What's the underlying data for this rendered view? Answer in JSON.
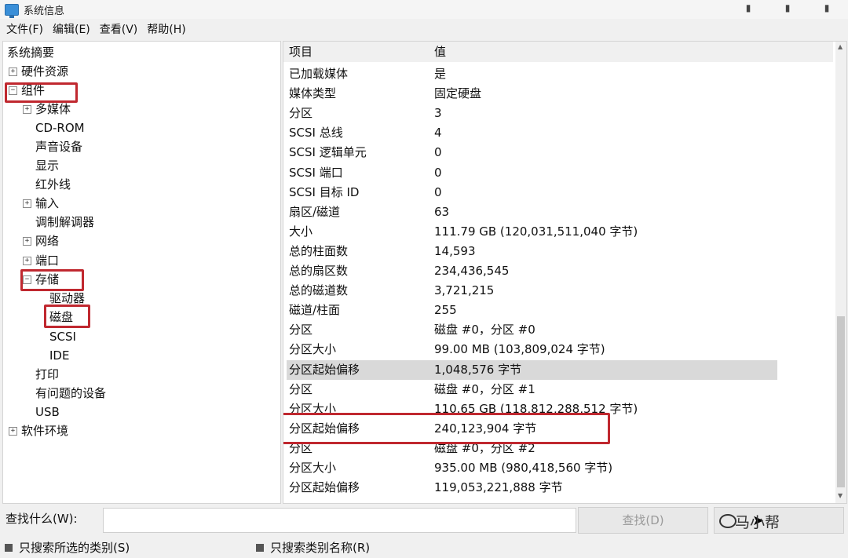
{
  "window": {
    "title": "系统信息",
    "controls": [
      "▮",
      "▮",
      "▮"
    ]
  },
  "menu": [
    "文件(F)",
    "编辑(E)",
    "查看(V)",
    "帮助(H)"
  ],
  "tree": [
    {
      "label": "系统摘要",
      "expander": ""
    },
    {
      "label": "硬件资源",
      "expander": "+"
    },
    {
      "label": "组件",
      "expander": "−"
    },
    {
      "label": "多媒体",
      "expander": "+"
    },
    {
      "label": "CD-ROM",
      "expander": ""
    },
    {
      "label": "声音设备",
      "expander": ""
    },
    {
      "label": "显示",
      "expander": ""
    },
    {
      "label": "红外线",
      "expander": ""
    },
    {
      "label": "输入",
      "expander": "+"
    },
    {
      "label": "调制解调器",
      "expander": ""
    },
    {
      "label": "网络",
      "expander": "+"
    },
    {
      "label": "端口",
      "expander": "+"
    },
    {
      "label": "存储",
      "expander": "−"
    },
    {
      "label": "驱动器",
      "expander": ""
    },
    {
      "label": "磁盘",
      "expander": ""
    },
    {
      "label": "SCSI",
      "expander": ""
    },
    {
      "label": "IDE",
      "expander": ""
    },
    {
      "label": "打印",
      "expander": ""
    },
    {
      "label": "有问题的设备",
      "expander": ""
    },
    {
      "label": "USB",
      "expander": ""
    },
    {
      "label": "软件环境",
      "expander": "+"
    }
  ],
  "table": {
    "headers": [
      "项目",
      "值"
    ],
    "rows": [
      [
        "已加载媒体",
        "是"
      ],
      [
        "媒体类型",
        "固定硬盘"
      ],
      [
        "分区",
        "3"
      ],
      [
        "SCSI 总线",
        "4"
      ],
      [
        "SCSI 逻辑单元",
        "0"
      ],
      [
        "SCSI 端口",
        "0"
      ],
      [
        "SCSI 目标 ID",
        "0"
      ],
      [
        "扇区/磁道",
        "63"
      ],
      [
        "大小",
        "111.79 GB (120,031,511,040 字节)"
      ],
      [
        "总的柱面数",
        "14,593"
      ],
      [
        "总的扇区数",
        "234,436,545"
      ],
      [
        "总的磁道数",
        "3,721,215"
      ],
      [
        "磁道/柱面",
        "255"
      ],
      [
        "分区",
        "磁盘 #0，分区 #0"
      ],
      [
        "分区大小",
        "99.00 MB (103,809,024 字节)"
      ],
      [
        "分区起始偏移",
        "1,048,576 字节"
      ],
      [
        "分区",
        "磁盘 #0，分区 #1"
      ],
      [
        "分区大小",
        "110.65 GB (118,812,288,512 字节)"
      ],
      [
        "分区起始偏移",
        "240,123,904 字节"
      ],
      [
        "分区",
        "磁盘 #0，分区 #2"
      ],
      [
        "分区大小",
        "935.00 MB (980,418,560 字节)"
      ],
      [
        "分区起始偏移",
        "119,053,221,888 字节"
      ]
    ]
  },
  "find": {
    "label": "查找什么(W):",
    "value": "",
    "find_button": "查找(D)",
    "watermark": "马小帮",
    "opt_selected": "只搜索所选的类别(S)",
    "opt_names": "只搜索类别名称(R)"
  }
}
